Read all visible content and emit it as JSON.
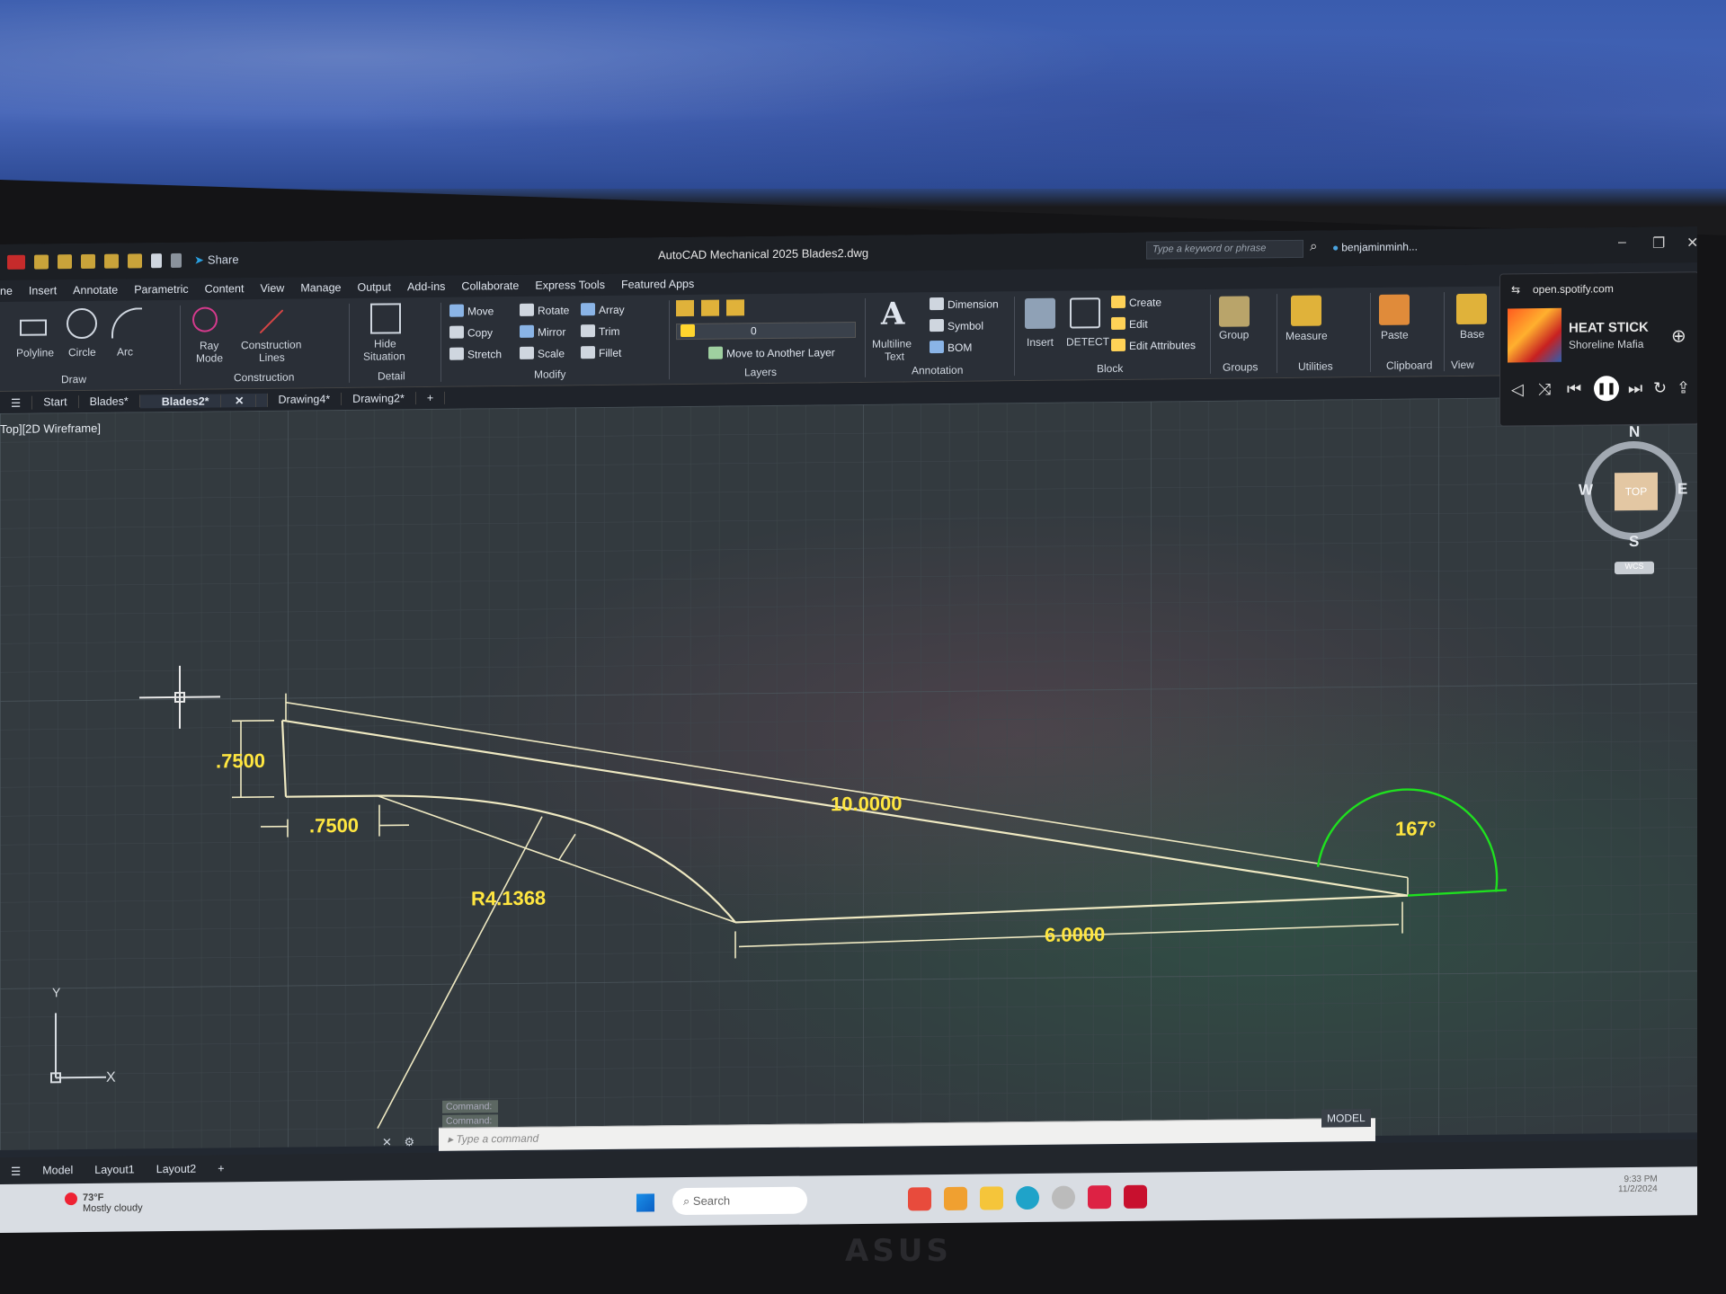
{
  "window": {
    "app_title": "AutoCAD Mechanical 2025   Blades2.dwg",
    "share_label": "Share",
    "search_placeholder": "Type a keyword or phrase",
    "user": "benjaminminh..."
  },
  "menu_tabs": [
    "ne",
    "Insert",
    "Annotate",
    "Parametric",
    "Content",
    "View",
    "Manage",
    "Output",
    "Add-ins",
    "Collaborate",
    "Express Tools",
    "Featured Apps"
  ],
  "ribbon": {
    "draw": {
      "polyline": "Polyline",
      "circle": "Circle",
      "arc": "Arc",
      "group": "Draw"
    },
    "construction": {
      "ray": "Ray",
      "ray2": "Mode",
      "clines": "Construction",
      "clines2": "Lines",
      "group": "Construction"
    },
    "detail": {
      "hide": "Hide",
      "hide2": "Situation",
      "group": "Detail"
    },
    "modify": {
      "move": "Move",
      "rotate": "Rotate",
      "array": "Array",
      "copy": "Copy",
      "mirror": "Mirror",
      "trim": "Trim",
      "stretch": "Stretch",
      "scale": "Scale",
      "fillet": "Fillet",
      "group": "Modify"
    },
    "layers": {
      "current": "0",
      "move_layer": "Move to Another Layer",
      "group": "Layers"
    },
    "annotation": {
      "mtext": "Multiline",
      "mtext2": "Text",
      "dimension": "Dimension",
      "symbol": "Symbol",
      "bom": "BOM",
      "group": "Annotation"
    },
    "block": {
      "insert": "Insert",
      "detect": "DETECT",
      "create": "Create",
      "edit": "Edit",
      "edit_attr": "Edit Attributes",
      "group": "Block"
    },
    "groups": {
      "group": "Group",
      "label": "Groups"
    },
    "utilities": {
      "measure": "Measure",
      "label": "Utilities"
    },
    "clipboard": {
      "paste": "Paste",
      "label": "Clipboard"
    },
    "view": {
      "base": "Base",
      "label": "View"
    }
  },
  "file_tabs": [
    "Start",
    "Blades*",
    "Blades2*",
    "Drawing4*",
    "Drawing2*"
  ],
  "viewport_label": "Top][2D Wireframe]",
  "dimensions": {
    "vertical": ".7500",
    "horizontal_short": ".7500",
    "long_edge": "10.0000",
    "base": "6.0000",
    "radius": "R4.1368",
    "angle": "167°"
  },
  "viewcube": {
    "n": "N",
    "s": "S",
    "e": "E",
    "w": "W",
    "top": "TOP",
    "wcs": "WCS"
  },
  "ucs": {
    "x": "X",
    "y": "Y"
  },
  "spotify": {
    "host": "open.spotify.com",
    "song": "HEAT STICK",
    "artist": "Shoreline Mafia"
  },
  "command": {
    "history": [
      "Command:",
      "Command:"
    ],
    "placeholder": "Type a command"
  },
  "layout_tabs": [
    "Model",
    "Layout1",
    "Layout2"
  ],
  "model_indicator": "MODEL",
  "taskbar": {
    "temp": "73°F",
    "weather": "Mostly cloudy",
    "search": "Search",
    "time": "9:33 PM",
    "date": "11/2/2024"
  },
  "colors": {
    "dimension_text": "#ffe640",
    "geometry": "#efe9c2",
    "angle_dim": "#1fe01f",
    "accent_tab": "#ffd257"
  },
  "brand": "ASUS"
}
